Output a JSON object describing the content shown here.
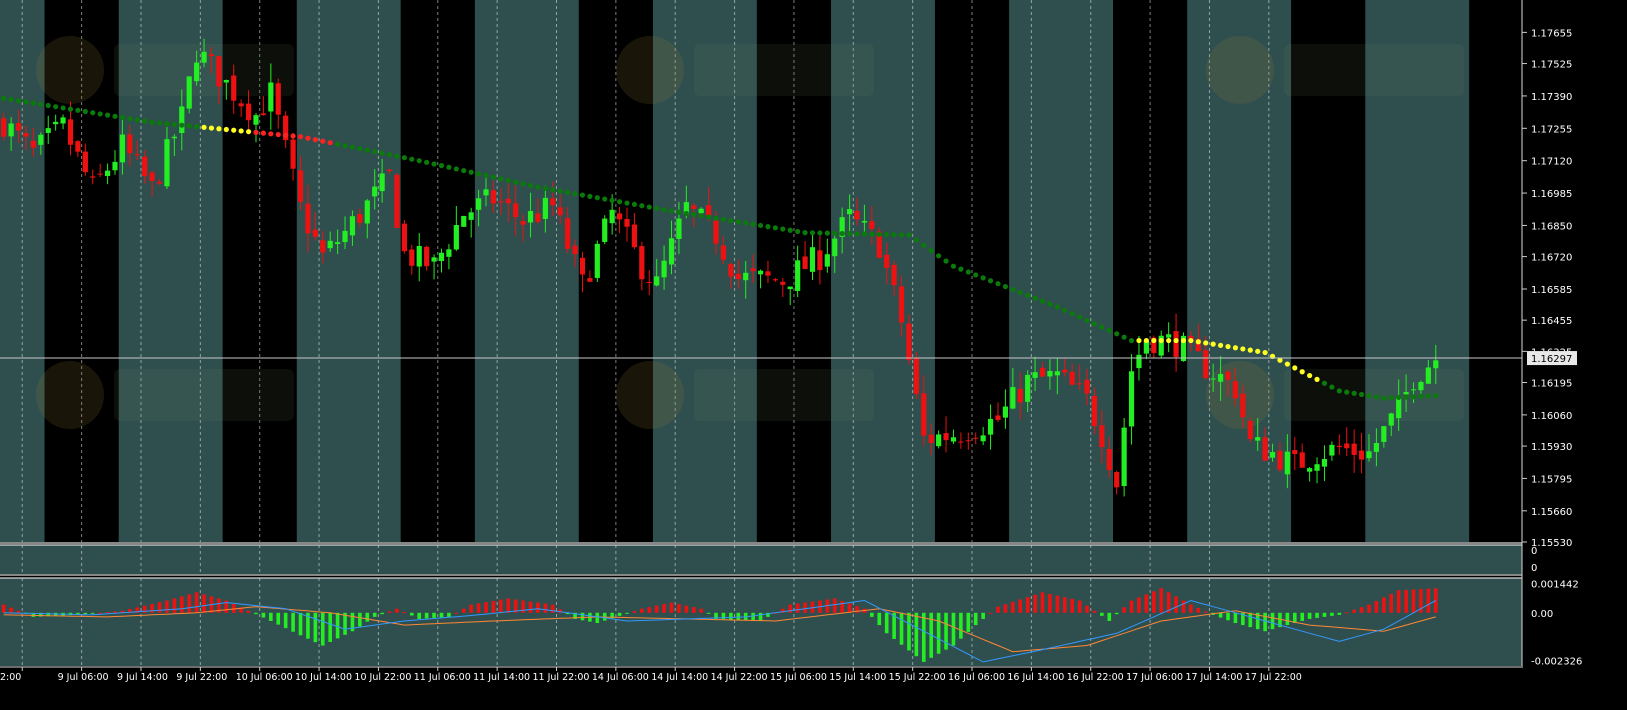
{
  "chart_data": {
    "type": "candlestick",
    "symbol_pair": "EURUSD",
    "colors": {
      "bull": "#22ee22",
      "bear": "#ee1111",
      "band_dark": "#000000",
      "band_light": "#2f4f4f",
      "ma_green": "#0a7a0a",
      "ma_yellow": "#ffff22",
      "ma_red": "#ff2222",
      "macd_fast": "#3399ff",
      "macd_slow": "#ff8833",
      "grid": "#e6e6e6",
      "axis_text": "#ffffff"
    },
    "price_axis": {
      "ylim": [
        1.1553,
        1.1779
      ],
      "ticks": [
        "1.17655",
        "1.17525",
        "1.17390",
        "1.17255",
        "1.17120",
        "1.16985",
        "1.16850",
        "1.16720",
        "1.16585",
        "1.16455",
        "1.16325",
        "1.16195",
        "1.16060",
        "1.15930",
        "1.15795",
        "1.15660",
        "1.15530"
      ],
      "current_price": "1.16297",
      "current_value": 1.16297
    },
    "time_axis": {
      "labels": [
        "2:00",
        "9 Jul 06:00",
        "9 Jul 14:00",
        "9 Jul 22:00",
        "10 Jul 06:00",
        "10 Jul 14:00",
        "10 Jul 22:00",
        "11 Jul 06:00",
        "11 Jul 14:00",
        "11 Jul 22:00",
        "14 Jul 06:00",
        "14 Jul 14:00",
        "14 Jul 22:00",
        "15 Jul 06:00",
        "15 Jul 14:00",
        "15 Jul 22:00",
        "16 Jul 06:00",
        "16 Jul 14:00",
        "16 Jul 22:00",
        "17 Jul 06:00",
        "17 Jul 14:00",
        "17 Jul 22:00"
      ],
      "bars_per_label": 8,
      "bar_count": 216
    },
    "sessions": [
      {
        "start": 6,
        "end": 16,
        "type": "dark"
      },
      {
        "start": 30,
        "end": 40,
        "type": "dark"
      },
      {
        "start": 54,
        "end": 64,
        "type": "dark"
      },
      {
        "start": 78,
        "end": 88,
        "type": "dark"
      },
      {
        "start": 102,
        "end": 112,
        "type": "dark"
      },
      {
        "start": 126,
        "end": 136,
        "type": "dark"
      },
      {
        "start": 150,
        "end": 160,
        "type": "dark"
      },
      {
        "start": 174,
        "end": 184,
        "type": "dark"
      },
      {
        "start": 198,
        "end": 208,
        "type": "dark"
      }
    ],
    "price_series": [
      {
        "bar": 0,
        "price": 1.1728
      },
      {
        "bar": 4,
        "price": 1.1715
      },
      {
        "bar": 8,
        "price": 1.1726
      },
      {
        "bar": 12,
        "price": 1.17
      },
      {
        "bar": 16,
        "price": 1.1718
      },
      {
        "bar": 20,
        "price": 1.17
      },
      {
        "bar": 24,
        "price": 1.173
      },
      {
        "bar": 26,
        "price": 1.1758
      },
      {
        "bar": 30,
        "price": 1.1744
      },
      {
        "bar": 34,
        "price": 1.1731
      },
      {
        "bar": 36,
        "price": 1.174
      },
      {
        "bar": 40,
        "price": 1.1692
      },
      {
        "bar": 43,
        "price": 1.1672
      },
      {
        "bar": 46,
        "price": 1.1682
      },
      {
        "bar": 52,
        "price": 1.1705
      },
      {
        "bar": 54,
        "price": 1.1673
      },
      {
        "bar": 58,
        "price": 1.1668
      },
      {
        "bar": 62,
        "price": 1.169
      },
      {
        "bar": 66,
        "price": 1.1696
      },
      {
        "bar": 70,
        "price": 1.1687
      },
      {
        "bar": 74,
        "price": 1.1693
      },
      {
        "bar": 78,
        "price": 1.166
      },
      {
        "bar": 82,
        "price": 1.169
      },
      {
        "bar": 86,
        "price": 1.1668
      },
      {
        "bar": 88,
        "price": 1.166
      },
      {
        "bar": 92,
        "price": 1.1692
      },
      {
        "bar": 96,
        "price": 1.1681
      },
      {
        "bar": 99,
        "price": 1.1663
      },
      {
        "bar": 105,
        "price": 1.1662
      },
      {
        "bar": 110,
        "price": 1.1672
      },
      {
        "bar": 114,
        "price": 1.1688
      },
      {
        "bar": 118,
        "price": 1.1677
      },
      {
        "bar": 121,
        "price": 1.1645
      },
      {
        "bar": 124,
        "price": 1.1596
      },
      {
        "bar": 128,
        "price": 1.1598
      },
      {
        "bar": 134,
        "price": 1.1604
      },
      {
        "bar": 138,
        "price": 1.162
      },
      {
        "bar": 142,
        "price": 1.1622
      },
      {
        "bar": 146,
        "price": 1.1612
      },
      {
        "bar": 148,
        "price": 1.1598
      },
      {
        "bar": 150,
        "price": 1.1578
      },
      {
        "bar": 152,
        "price": 1.1625
      },
      {
        "bar": 154,
        "price": 1.1638
      },
      {
        "bar": 158,
        "price": 1.1636
      },
      {
        "bar": 162,
        "price": 1.1626
      },
      {
        "bar": 166,
        "price": 1.1617
      },
      {
        "bar": 168,
        "price": 1.1594
      },
      {
        "bar": 171,
        "price": 1.159
      },
      {
        "bar": 174,
        "price": 1.1585
      },
      {
        "bar": 177,
        "price": 1.159
      },
      {
        "bar": 180,
        "price": 1.1592
      },
      {
        "bar": 184,
        "price": 1.159
      },
      {
        "bar": 188,
        "price": 1.1608
      },
      {
        "bar": 190,
        "price": 1.1622
      },
      {
        "bar": 193,
        "price": 1.163
      }
    ],
    "ma_series": [
      {
        "bar": 0,
        "price": 1.1738
      },
      {
        "bar": 20,
        "price": 1.1728
      },
      {
        "bar": 40,
        "price": 1.1722
      },
      {
        "bar": 56,
        "price": 1.1712
      },
      {
        "bar": 72,
        "price": 1.1701
      },
      {
        "bar": 90,
        "price": 1.1691
      },
      {
        "bar": 108,
        "price": 1.1682
      },
      {
        "bar": 122,
        "price": 1.1681
      },
      {
        "bar": 128,
        "price": 1.1668
      },
      {
        "bar": 142,
        "price": 1.1651
      },
      {
        "bar": 152,
        "price": 1.1637
      },
      {
        "bar": 160,
        "price": 1.1637
      },
      {
        "bar": 170,
        "price": 1.1632
      },
      {
        "bar": 180,
        "price": 1.1616
      },
      {
        "bar": 186,
        "price": 1.1613
      },
      {
        "bar": 193,
        "price": 1.1614
      }
    ],
    "ma_segments": [
      {
        "start": 27,
        "end": 34,
        "color": "yellow"
      },
      {
        "start": 34,
        "end": 44,
        "color": "red"
      },
      {
        "start": 153,
        "end": 177,
        "color": "yellow"
      }
    ],
    "separator_pane": {
      "labels": [
        "0",
        "0"
      ]
    },
    "macd_axis": {
      "ylim": [
        -0.0026,
        0.0017
      ],
      "ticks": [
        {
          "label": "0.001442",
          "value": 0.001442
        },
        {
          "label": "0.00",
          "value": 0.0
        },
        {
          "label": "-0.002326",
          "value": -0.002326
        }
      ]
    },
    "macd_histogram": [
      {
        "bar": 0,
        "value": 0.0004
      },
      {
        "bar": 4,
        "value": -0.0002
      },
      {
        "bar": 10,
        "value": -0.0001
      },
      {
        "bar": 16,
        "value": 0.0001
      },
      {
        "bar": 22,
        "value": 0.0006
      },
      {
        "bar": 26,
        "value": 0.001
      },
      {
        "bar": 30,
        "value": 0.0006
      },
      {
        "bar": 33,
        "value": 0.0001
      },
      {
        "bar": 36,
        "value": -0.0004
      },
      {
        "bar": 40,
        "value": -0.0011
      },
      {
        "bar": 43,
        "value": -0.0016
      },
      {
        "bar": 47,
        "value": -0.0009
      },
      {
        "bar": 50,
        "value": -0.0002
      },
      {
        "bar": 53,
        "value": 0.0002
      },
      {
        "bar": 56,
        "value": -0.0003
      },
      {
        "bar": 60,
        "value": -0.0002
      },
      {
        "bar": 63,
        "value": 0.0004
      },
      {
        "bar": 68,
        "value": 0.0007
      },
      {
        "bar": 74,
        "value": 0.0004
      },
      {
        "bar": 77,
        "value": -0.0003
      },
      {
        "bar": 80,
        "value": -0.0005
      },
      {
        "bar": 86,
        "value": 0.0002
      },
      {
        "bar": 90,
        "value": 0.0005
      },
      {
        "bar": 94,
        "value": 0.0002
      },
      {
        "bar": 96,
        "value": -0.0003
      },
      {
        "bar": 102,
        "value": -0.0004
      },
      {
        "bar": 106,
        "value": 0.0004
      },
      {
        "bar": 112,
        "value": 0.0007
      },
      {
        "bar": 116,
        "value": 0.0002
      },
      {
        "bar": 119,
        "value": -0.001
      },
      {
        "bar": 124,
        "value": -0.0024
      },
      {
        "bar": 128,
        "value": -0.0016
      },
      {
        "bar": 131,
        "value": -0.0006
      },
      {
        "bar": 134,
        "value": 0.0003
      },
      {
        "bar": 140,
        "value": 0.001
      },
      {
        "bar": 145,
        "value": 0.0006
      },
      {
        "bar": 147,
        "value": 0.0001
      },
      {
        "bar": 149,
        "value": -0.0004
      },
      {
        "bar": 152,
        "value": 0.0006
      },
      {
        "bar": 156,
        "value": 0.0012
      },
      {
        "bar": 160,
        "value": 0.0004
      },
      {
        "bar": 163,
        "value": -0.0001
      },
      {
        "bar": 166,
        "value": -0.0005
      },
      {
        "bar": 170,
        "value": -0.0009
      },
      {
        "bar": 176,
        "value": -0.0003
      },
      {
        "bar": 180,
        "value": -0.0001
      },
      {
        "bar": 184,
        "value": 0.0004
      },
      {
        "bar": 188,
        "value": 0.0011
      },
      {
        "bar": 193,
        "value": 0.0012
      }
    ],
    "macd_fast_line": [
      {
        "bar": 0,
        "value": 0.0
      },
      {
        "bar": 12,
        "value": -0.0001
      },
      {
        "bar": 24,
        "value": 0.0002
      },
      {
        "bar": 30,
        "value": 0.0005
      },
      {
        "bar": 38,
        "value": 0.0002
      },
      {
        "bar": 46,
        "value": -0.0008
      },
      {
        "bar": 54,
        "value": -0.0004
      },
      {
        "bar": 64,
        "value": -0.0001
      },
      {
        "bar": 72,
        "value": 0.0002
      },
      {
        "bar": 84,
        "value": -0.0004
      },
      {
        "bar": 100,
        "value": -0.0002
      },
      {
        "bar": 116,
        "value": 0.0006
      },
      {
        "bar": 124,
        "value": -0.0009
      },
      {
        "bar": 132,
        "value": -0.0024
      },
      {
        "bar": 140,
        "value": -0.0018
      },
      {
        "bar": 150,
        "value": -0.001
      },
      {
        "bar": 160,
        "value": 0.0006
      },
      {
        "bar": 170,
        "value": -0.0004
      },
      {
        "bar": 180,
        "value": -0.0014
      },
      {
        "bar": 186,
        "value": -0.0008
      },
      {
        "bar": 193,
        "value": 0.0006
      }
    ],
    "macd_slow_line": [
      {
        "bar": 0,
        "value": -0.0001
      },
      {
        "bar": 14,
        "value": -0.0002
      },
      {
        "bar": 26,
        "value": 0.0
      },
      {
        "bar": 34,
        "value": 0.0003
      },
      {
        "bar": 44,
        "value": 0.0
      },
      {
        "bar": 54,
        "value": -0.0006
      },
      {
        "bar": 66,
        "value": -0.0004
      },
      {
        "bar": 80,
        "value": -0.0002
      },
      {
        "bar": 92,
        "value": -0.0003
      },
      {
        "bar": 104,
        "value": -0.0004
      },
      {
        "bar": 118,
        "value": 0.0002
      },
      {
        "bar": 126,
        "value": -0.0004
      },
      {
        "bar": 136,
        "value": -0.0019
      },
      {
        "bar": 146,
        "value": -0.0016
      },
      {
        "bar": 156,
        "value": -0.0004
      },
      {
        "bar": 166,
        "value": 0.0001
      },
      {
        "bar": 176,
        "value": -0.0006
      },
      {
        "bar": 186,
        "value": -0.0009
      },
      {
        "bar": 193,
        "value": -0.0002
      }
    ]
  }
}
